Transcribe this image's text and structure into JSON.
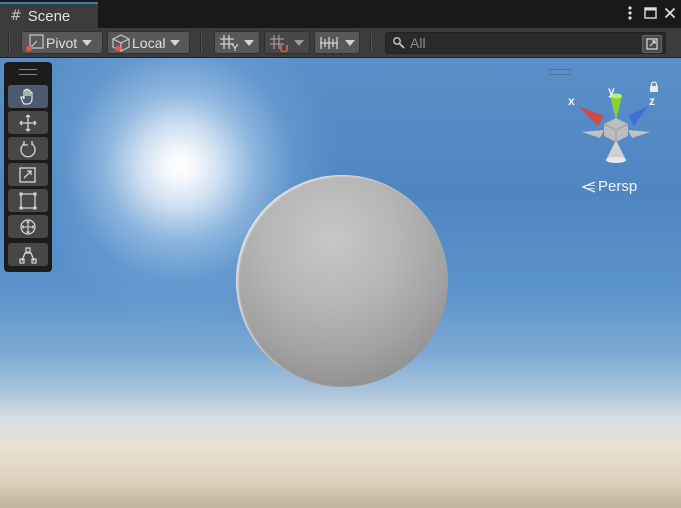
{
  "tab": {
    "title": "Scene"
  },
  "toolbar": {
    "pivot_label": "Pivot",
    "local_label": "Local",
    "search_placeholder": "All"
  },
  "tools": [
    {
      "name": "hand-tool",
      "active": true
    },
    {
      "name": "move-tool"
    },
    {
      "name": "rotate-tool"
    },
    {
      "name": "scale-tool"
    },
    {
      "name": "rect-tool"
    },
    {
      "name": "transform-tool"
    },
    {
      "name": "custom-tool"
    }
  ],
  "gizmo": {
    "x_label": "x",
    "y_label": "y",
    "z_label": "z",
    "projection": "Persp"
  },
  "colors": {
    "accent": "#3a79bb",
    "x_axis": "#d04a4a",
    "y_axis": "#86d13a",
    "z_axis": "#3f6fd8"
  }
}
